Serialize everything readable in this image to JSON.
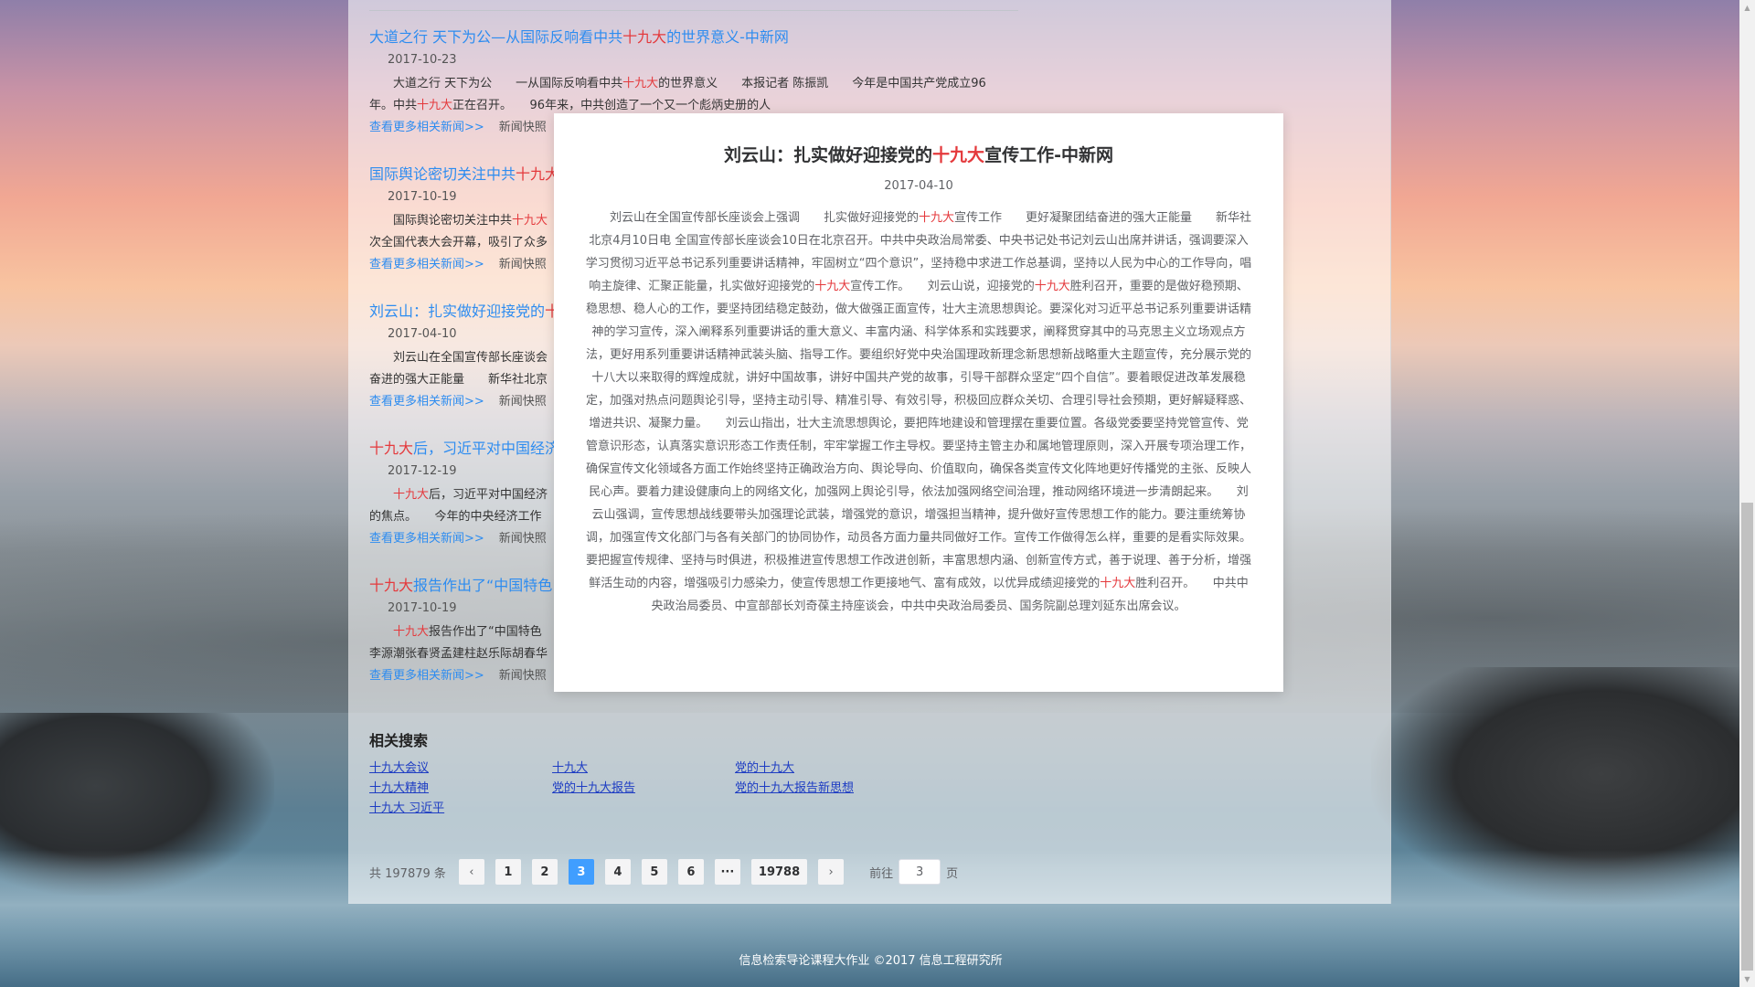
{
  "results": [
    {
      "title_pre": "大道之行 天下为公—从国际反响看中共",
      "title_hl": "十九大",
      "title_post": "的世界意义-中新网",
      "date": "2017-10-23",
      "snip1": "大道之行 天下为公　　一从国际反响看中共",
      "snip1_hl": "十九大",
      "snip2": "的世界意义　　本报记者 陈振凯　　今年是中国共产党成立96年。中共",
      "snip2_hl": "十九大",
      "snip3": "正在召开。　　96年来，中共创造了一个又一个彪炳史册的人",
      "more": "查看更多相关新闻>>",
      "category": "新闻快照"
    },
    {
      "title_pre": "国际舆论密切关注中共",
      "title_hl": "十九大",
      "title_post": "",
      "date": "2017-10-19",
      "snip1": "国际舆论密切关注中共",
      "snip1_hl": "十九大",
      "snip2": "次全国代表大会开幕，吸引了众多",
      "snip2_hl": "",
      "snip3": "",
      "more": "查看更多相关新闻>>",
      "category": "新闻快照"
    },
    {
      "title_pre": "刘云山：扎实做好迎接党的",
      "title_hl": "十",
      "title_post": "",
      "date": "2017-04-10",
      "snip1": "刘云山在全国宣传部长座谈会",
      "snip1_hl": "",
      "snip2": "奋进的强大正能量　　新华社北京",
      "snip2_hl": "",
      "snip3": "",
      "more": "查看更多相关新闻>>",
      "category": "新闻快照"
    },
    {
      "title_pre": "",
      "title_hl": "十九大",
      "title_post": "后，习近平对中国经济",
      "date": "2017-12-19",
      "snip1": "",
      "snip1_hl": "十九大",
      "snip2": "后，习近平对中国经济",
      "snip2_hl": "",
      "snip3": "的焦点。　　今年的中央经济工作",
      "more": "查看更多相关新闻>>",
      "category": "新闻快照"
    },
    {
      "title_pre": "",
      "title_hl": "十九大",
      "title_post": "报告作出了“中国特色",
      "date": "2017-10-19",
      "snip1": "",
      "snip1_hl": "十九大",
      "snip2": "报告作出了“中国特色",
      "snip2_hl": "",
      "snip3": "李源潮张春贤孟建柱赵乐际胡春华",
      "more": "查看更多相关新闻>>",
      "category": "新闻快照"
    }
  ],
  "related": {
    "title": "相关搜索",
    "links": [
      "十九大会议",
      "十九大",
      "党的十九大",
      "十九大精神",
      "党的十九大报告",
      "党的十九大报告新思想",
      "十九大 习近平"
    ]
  },
  "pager": {
    "total": "共 197879 条",
    "prev": "‹",
    "next": "›",
    "pages": [
      "1",
      "2",
      "3",
      "4",
      "5",
      "6",
      "···",
      "19788"
    ],
    "current": "3",
    "goto_label": "前往",
    "goto_value": "3",
    "page_unit": "页"
  },
  "popup": {
    "title_pre": "刘云山：扎实做好迎接党的",
    "title_hl": "十九大",
    "title_post": "宣传工作-中新网",
    "date": "2017-04-10",
    "p1": "　　刘云山在全国宣传部长座谈会上强调　　扎实做好迎接党的",
    "p1_hl": "十九大",
    "p2": "宣传工作　　更好凝聚团结奋进的强大正能量　　新华社北京4月10日电 全国宣传部长座谈会10日在北京召开。中共中央政治局常委、中央书记处书记刘云山出席并讲话，强调要深入学习贯彻习近平总书记系列重要讲话精神，牢固树立“四个意识”，坚持稳中求进工作总基调，坚持以人民为中心的工作导向，唱响主旋律、汇聚正能量，扎实做好迎接党的",
    "p2_hl": "十九大",
    "p3": "宣传工作。　　刘云山说，迎接党的",
    "p3_hl": "十九大",
    "p4": "胜利召开，重要的是做好稳预期、稳思想、稳人心的工作，要坚持团结稳定鼓劲，做大做强正面宣传，壮大主流思想舆论。要深化对习近平总书记系列重要讲话精神的学习宣传，深入阐释系列重要讲话的重大意义、丰富内涵、科学体系和实践要求，阐释贯穿其中的马克思主义立场观点方法，更好用系列重要讲话精神武装头脑、指导工作。要组织好党中央治国理政新理念新思想新战略重大主题宣传，充分展示党的十八大以来取得的辉煌成就，讲好中国故事，讲好中国共产党的故事，引导干部群众坚定“四个自信”。要着眼促进改革发展稳定，加强对热点问题舆论引导，坚持主动引导、精准引导、有效引导，积极回应群众关切、合理引导社会预期，更好解疑释惑、增进共识、凝聚力量。　　刘云山指出，壮大主流思想舆论，要把阵地建设和管理摆在重要位置。各级党委要坚持党管宣传、党管意识形态，认真落实意识形态工作责任制，牢牢掌握工作主导权。要坚持主管主办和属地管理原则，深入开展专项治理工作，确保宣传文化领域各方面工作始终坚持正确政治方向、舆论导向、价值取向，确保各类宣传文化阵地更好传播党的主张、反映人民心声。要着力建设健康向上的网络文化，加强网上舆论引导，依法加强网络空间治理，推动网络环境进一步清朗起来。　　刘云山强调，宣传思想战线要带头加强理论武装，增强党的意识，增强担当精神，提升做好宣传思想工作的能力。要注重统筹协调，加强宣传文化部门与各有关部门的协同协作，动员各方面力量共同做好工作。宣传工作做得怎么样，重要的是看实际效果。要把握宣传规律、坚持与时俱进，积极推进宣传思想工作改进创新，丰富思想内涵、创新宣传方式，善于说理、善于分析，增强鲜活生动的内容，增强吸引力感染力，使宣传思想工作更接地气、富有成效，以优异成绩迎接党的",
    "p4_hl": "十九大",
    "p5": "胜利召开。　　中共中央政治局委员、中宣部部长刘奇葆主持座谈会，中共中央政治局委员、国务院副总理刘延东出席会议。"
  },
  "footer": "信息检索导论课程大作业 ©2017 信息工程研究所",
  "colors": {
    "link": "#2d8cf0",
    "highlight": "#e4393c",
    "active_page": "#409eff"
  }
}
